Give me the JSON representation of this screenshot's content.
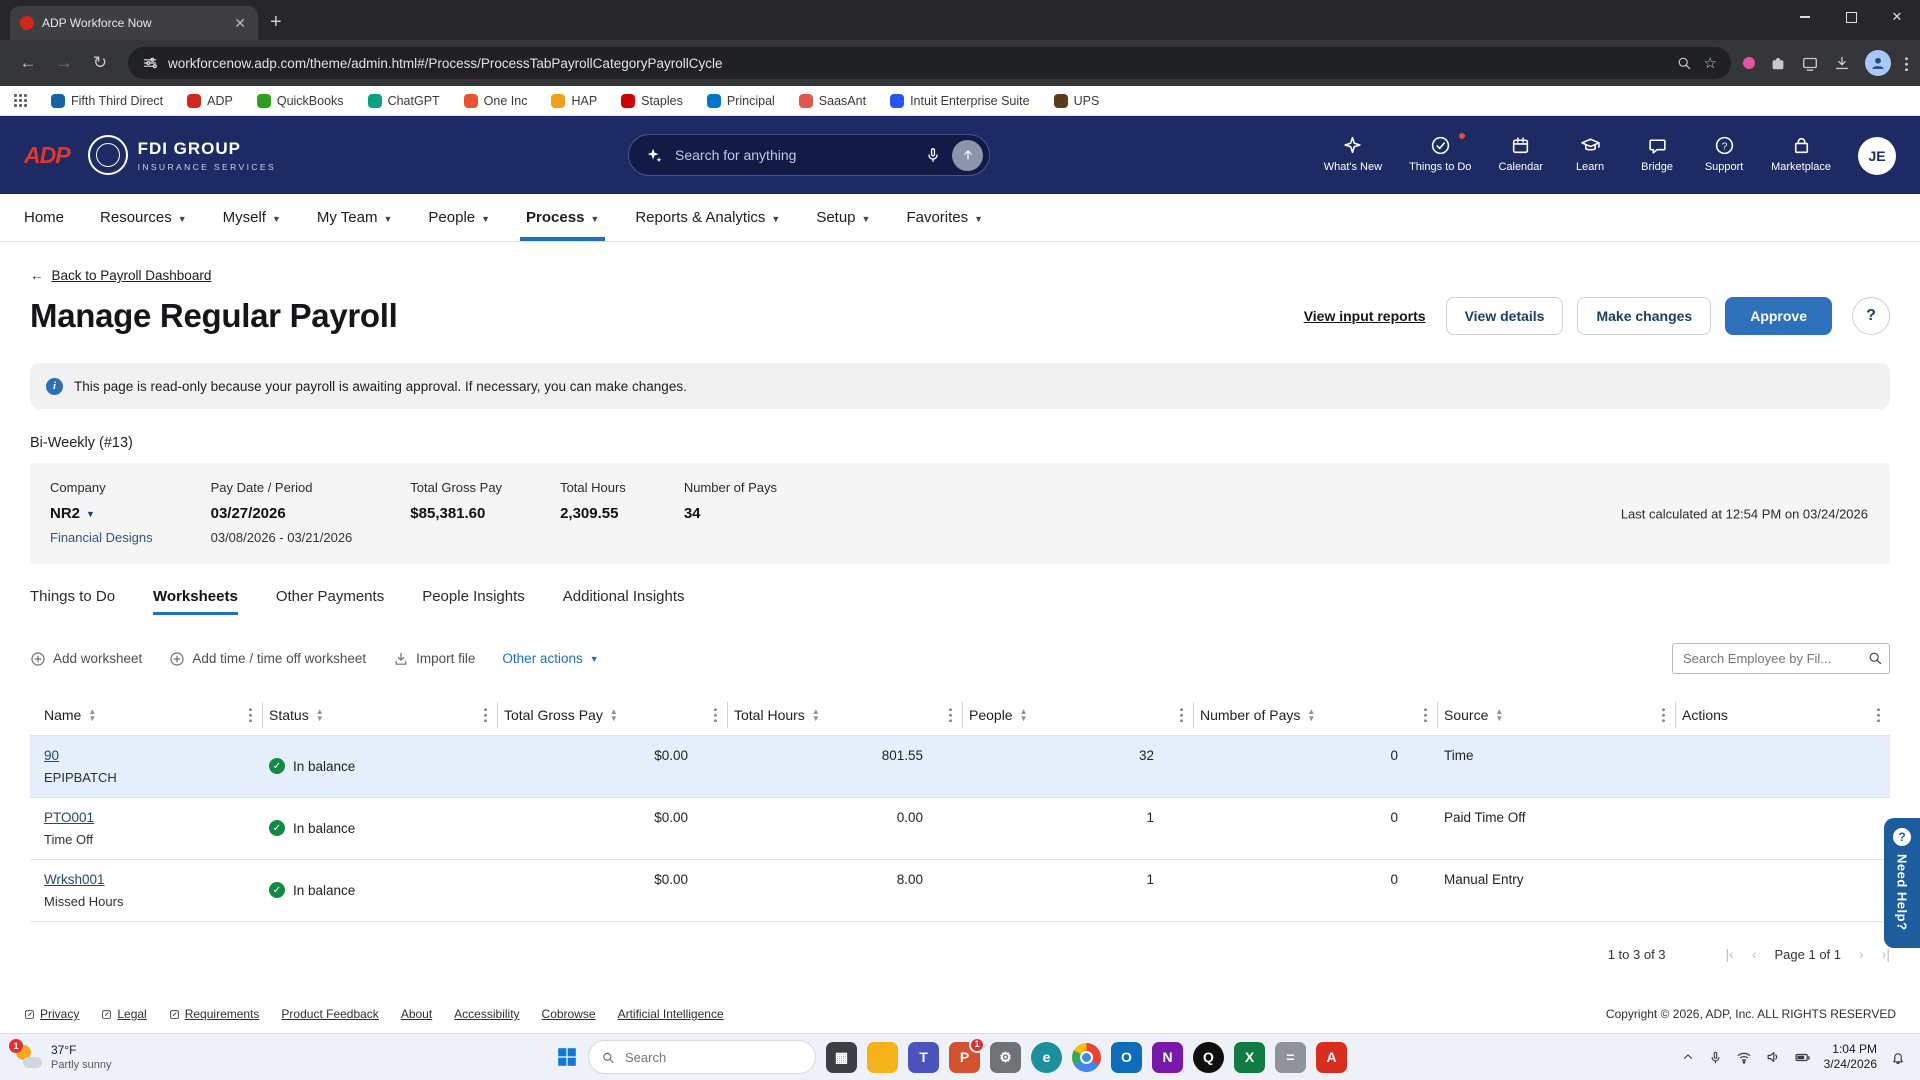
{
  "browser": {
    "tab_title": "ADP Workforce Now",
    "url": "workforcenow.adp.com/theme/admin.html#/Process/ProcessTabPayrollCategoryPayrollCycle",
    "bookmarks": [
      {
        "label": "Fifth Third Direct",
        "color": "#1661a8"
      },
      {
        "label": "ADP",
        "color": "#d0271d"
      },
      {
        "label": "QuickBooks",
        "color": "#2ca01c"
      },
      {
        "label": "ChatGPT",
        "color": "#0ba37f"
      },
      {
        "label": "One Inc",
        "color": "#e8542e"
      },
      {
        "label": "HAP",
        "color": "#f0a11c"
      },
      {
        "label": "Staples",
        "color": "#cc0000"
      },
      {
        "label": "Principal",
        "color": "#0076cf"
      },
      {
        "label": "SaasAnt",
        "color": "#e2574c"
      },
      {
        "label": "Intuit Enterprise Suite",
        "color": "#2356f6"
      },
      {
        "label": "UPS",
        "color": "#5b3a1e"
      }
    ]
  },
  "header": {
    "logo": "ADP",
    "brand_line1": "FDI GROUP",
    "brand_line2": "INSURANCE SERVICES",
    "search_placeholder": "Search for anything",
    "quick_links": [
      "What's New",
      "Things to Do",
      "Calendar",
      "Learn",
      "Bridge",
      "Support",
      "Marketplace"
    ],
    "avatar_initials": "JE"
  },
  "nav": {
    "items": [
      "Home",
      "Resources",
      "Myself",
      "My Team",
      "People",
      "Process",
      "Reports & Analytics",
      "Setup",
      "Favorites"
    ],
    "active": "Process"
  },
  "page": {
    "back_link": "Back to Payroll Dashboard",
    "title": "Manage Regular Payroll",
    "actions": {
      "view_input_reports": "View input reports",
      "view_details": "View details",
      "make_changes": "Make changes",
      "approve": "Approve"
    },
    "info_banner": "This page is read-only because your payroll is awaiting approval. If necessary, you can make changes.",
    "cycle_label": "Bi-Weekly (#13)"
  },
  "summary": {
    "company_label": "Company",
    "company_value": "NR2",
    "company_sub": "Financial Designs",
    "pay_date_label": "Pay Date / Period",
    "pay_date": "03/27/2026",
    "pay_period": "03/08/2026 - 03/21/2026",
    "gross_label": "Total Gross Pay",
    "gross_value": "$85,381.60",
    "hours_label": "Total Hours",
    "hours_value": "2,309.55",
    "pays_label": "Number of Pays",
    "pays_value": "34",
    "last_calculated": "Last calculated at 12:54 PM on 03/24/2026"
  },
  "tabs": [
    "Things to Do",
    "Worksheets",
    "Other Payments",
    "People Insights",
    "Additional Insights"
  ],
  "active_tab": "Worksheets",
  "toolbar": {
    "add_worksheet": "Add worksheet",
    "add_time_worksheet": "Add time / time off worksheet",
    "import_file": "Import file",
    "other_actions": "Other actions",
    "search_placeholder": "Search Employee by Fil..."
  },
  "table": {
    "columns": [
      "Name",
      "Status",
      "Total Gross Pay",
      "Total Hours",
      "People",
      "Number of Pays",
      "Source",
      "Actions"
    ],
    "rows": [
      {
        "name": "90",
        "sub": "EPIPBATCH",
        "status": "In balance",
        "gross": "$0.00",
        "hours": "801.55",
        "people": "32",
        "pays": "0",
        "source": "Time"
      },
      {
        "name": "PTO001",
        "sub": "Time Off",
        "status": "In balance",
        "gross": "$0.00",
        "hours": "0.00",
        "people": "1",
        "pays": "0",
        "source": "Paid Time Off"
      },
      {
        "name": "Wrksh001",
        "sub": "Missed Hours",
        "status": "In balance",
        "gross": "$0.00",
        "hours": "8.00",
        "people": "1",
        "pays": "0",
        "source": "Manual Entry"
      }
    ]
  },
  "pagination": {
    "range": "1 to 3 of 3",
    "page": "Page 1 of 1"
  },
  "need_help": "Need Help?",
  "footer": {
    "links": [
      "Privacy",
      "Legal",
      "Requirements",
      "Product Feedback",
      "About",
      "Accessibility",
      "Cobrowse",
      "Artificial Intelligence"
    ],
    "copyright": "Copyright © 2026, ADP, Inc. ALL RIGHTS RESERVED"
  },
  "taskbar": {
    "weather_temp": "37°F",
    "weather_desc": "Partly sunny",
    "weather_badge": "1",
    "search_placeholder": "Search",
    "apps": [
      {
        "name": "task-view",
        "glyph": "▦",
        "color": "#3c3f44"
      },
      {
        "name": "file-explorer",
        "glyph": "",
        "color": "#f6b21a"
      },
      {
        "name": "teams",
        "glyph": "T",
        "color": "#4b53bc"
      },
      {
        "name": "powerpoint",
        "glyph": "P",
        "color": "#d35230",
        "badge": "1"
      },
      {
        "name": "settings",
        "glyph": "⚙",
        "color": "#6f7276"
      },
      {
        "name": "edge",
        "glyph": "e",
        "color": "#1b8f9e"
      },
      {
        "name": "chrome",
        "glyph": "",
        "color": ""
      },
      {
        "name": "outlook",
        "glyph": "O",
        "color": "#0f6cbd"
      },
      {
        "name": "onenote",
        "glyph": "N",
        "color": "#7719aa"
      },
      {
        "name": "quickbooks",
        "glyph": "Q",
        "color": "#101010"
      },
      {
        "name": "excel",
        "glyph": "X",
        "color": "#107c41"
      },
      {
        "name": "calculator",
        "glyph": "=",
        "color": "#8f949a"
      },
      {
        "name": "acrobat",
        "glyph": "A",
        "color": "#d92d20"
      }
    ],
    "time": "1:04 PM",
    "date": "3/24/2026"
  }
}
